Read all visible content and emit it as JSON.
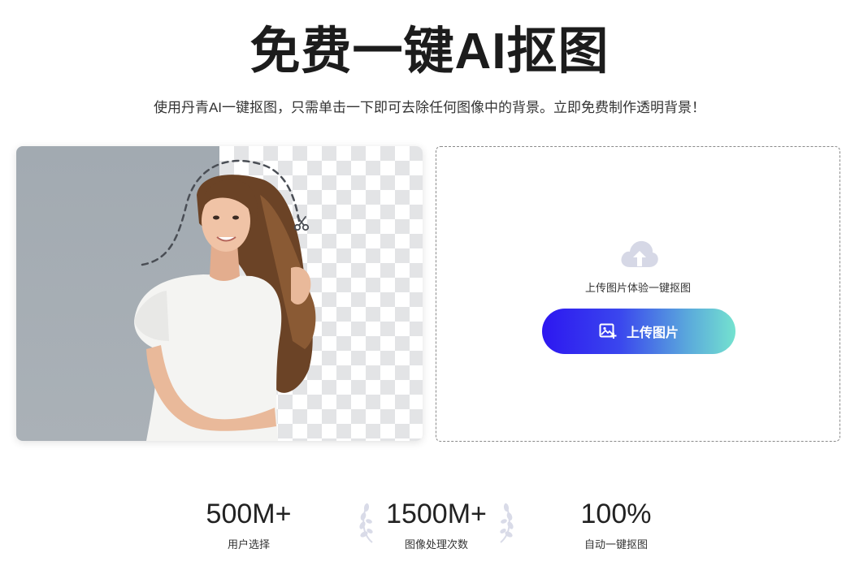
{
  "hero": {
    "title": "免费一键AI抠图",
    "subtitle": "使用丹青AI一键抠图，只需单击一下即可去除任何图像中的背景。立即免费制作透明背景！"
  },
  "upload": {
    "hint": "上传图片体验一键抠图",
    "button_label": "上传图片"
  },
  "stats": [
    {
      "value": "500M+",
      "label": "用户选择"
    },
    {
      "value": "1500M+",
      "label": "图像处理次数"
    },
    {
      "value": "100%",
      "label": "自动一键抠图"
    }
  ],
  "colors": {
    "button_gradient_start": "#2d17f0",
    "button_gradient_end": "#74e2cf",
    "cloud_icon": "#d6d8e6",
    "laurel": "#d9dbe8"
  },
  "icons": {
    "cloud": "cloud-upload-icon",
    "image_add": "image-add-icon",
    "scissors": "scissors-icon",
    "laurel": "laurel-icon"
  }
}
